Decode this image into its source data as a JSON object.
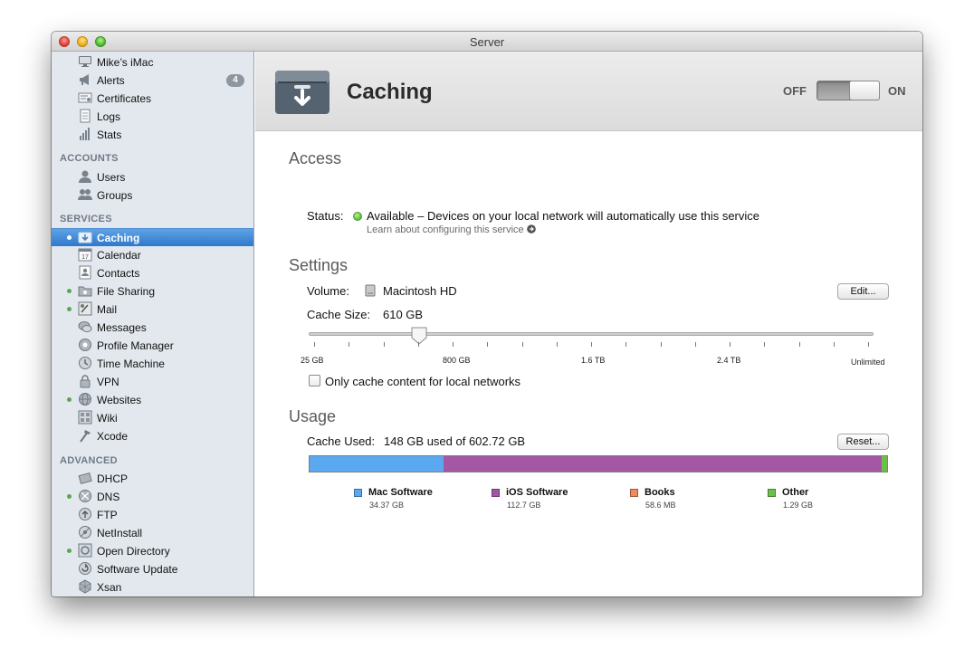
{
  "window": {
    "title": "Server"
  },
  "sidebar": {
    "top_items": [
      {
        "label": "Mike’s iMac",
        "icon": "imac-icon"
      },
      {
        "label": "Alerts",
        "icon": "megaphone-icon",
        "badge": "4"
      },
      {
        "label": "Certificates",
        "icon": "certificate-icon"
      },
      {
        "label": "Logs",
        "icon": "logs-icon"
      },
      {
        "label": "Stats",
        "icon": "stats-icon"
      }
    ],
    "accounts_header": "ACCOUNTS",
    "accounts": [
      {
        "label": "Users",
        "icon": "user-icon"
      },
      {
        "label": "Groups",
        "icon": "group-icon"
      }
    ],
    "services_header": "SERVICES",
    "services": [
      {
        "label": "Caching",
        "icon": "caching-icon",
        "active": true,
        "selected": true
      },
      {
        "label": "Calendar",
        "icon": "calendar-icon",
        "active": false
      },
      {
        "label": "Contacts",
        "icon": "contacts-icon",
        "active": false
      },
      {
        "label": "File Sharing",
        "icon": "file-sharing-icon",
        "active": true
      },
      {
        "label": "Mail",
        "icon": "mail-icon",
        "active": true
      },
      {
        "label": "Messages",
        "icon": "messages-icon",
        "active": false
      },
      {
        "label": "Profile Manager",
        "icon": "profile-manager-icon",
        "active": false
      },
      {
        "label": "Time Machine",
        "icon": "time-machine-icon",
        "active": false
      },
      {
        "label": "VPN",
        "icon": "vpn-icon",
        "active": false
      },
      {
        "label": "Websites",
        "icon": "websites-icon",
        "active": true
      },
      {
        "label": "Wiki",
        "icon": "wiki-icon",
        "active": false
      },
      {
        "label": "Xcode",
        "icon": "xcode-icon",
        "active": false
      }
    ],
    "advanced_header": "ADVANCED",
    "advanced": [
      {
        "label": "DHCP",
        "icon": "dhcp-icon",
        "active": false
      },
      {
        "label": "DNS",
        "icon": "dns-icon",
        "active": true
      },
      {
        "label": "FTP",
        "icon": "ftp-icon",
        "active": false
      },
      {
        "label": "NetInstall",
        "icon": "netinstall-icon",
        "active": false
      },
      {
        "label": "Open Directory",
        "icon": "open-directory-icon",
        "active": true
      },
      {
        "label": "Software Update",
        "icon": "software-update-icon",
        "active": false
      },
      {
        "label": "Xsan",
        "icon": "xsan-icon",
        "active": false
      }
    ]
  },
  "header": {
    "title": "Caching",
    "toggle_off": "OFF",
    "toggle_on": "ON",
    "toggle_state": "ON"
  },
  "access": {
    "title": "Access",
    "status_label": "Status:",
    "status_text": "Available – Devices on your local network will automatically use this service",
    "learn_link": "Learn about configuring this service"
  },
  "settings": {
    "title": "Settings",
    "volume_label": "Volume:",
    "volume_value": "Macintosh HD",
    "edit_button": "Edit...",
    "cache_size_label": "Cache Size:",
    "cache_size_value": "610 GB",
    "slider_fraction": 0.19,
    "slider_ticks": [
      "25 GB",
      "800 GB",
      "1.6 TB",
      "2.4 TB",
      "Unlimited"
    ],
    "checkbox_label": "Only cache content for local networks",
    "checkbox_checked": false
  },
  "usage": {
    "title": "Usage",
    "cache_used_label": "Cache Used:",
    "cache_used_value": "148 GB used of 602.72 GB",
    "reset_button": "Reset...",
    "total_gb": 602.72,
    "categories": [
      {
        "name": "Mac Software",
        "value": "34.37 GB",
        "gb": 34.37,
        "color": "#5aa9f0"
      },
      {
        "name": "iOS Software",
        "value": "112.7 GB",
        "gb": 112.7,
        "color": "#a357a5"
      },
      {
        "name": "Books",
        "value": "58.6 MB",
        "gb": 0.0586,
        "color": "#f08a5d"
      },
      {
        "name": "Other",
        "value": "1.29 GB",
        "gb": 1.29,
        "color": "#6cc04a"
      }
    ]
  },
  "colors": {
    "accent": "#2e78cc",
    "status_green": "#5cbb38"
  }
}
